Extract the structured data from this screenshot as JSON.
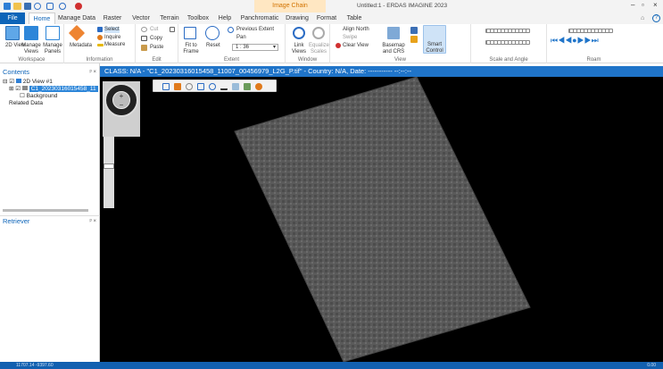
{
  "titlebar": {
    "context_group": "Image Chain",
    "window_title": "Untitled:1 - ERDAS IMAGINE 2023",
    "quick_access": [
      "folder-open-icon",
      "save-icon",
      "undo-icon",
      "cursor-icon",
      "zoom-icon",
      "close-icon"
    ]
  },
  "tabs": [
    "File",
    "Home",
    "Manage Data",
    "Raster",
    "Vector",
    "Terrain",
    "Toolbox",
    "Help",
    "Panchromatic",
    "Drawing",
    "Format",
    "Table"
  ],
  "ribbon": {
    "workspace": {
      "label": "Workspace",
      "buttons": [
        "2D View",
        "Manage Views",
        "Manage Panels"
      ]
    },
    "information": {
      "label": "Information",
      "buttons": [
        "Metadata",
        "Select",
        "Inquire",
        "Measure"
      ]
    },
    "edit": {
      "label": "Edit",
      "buttons": [
        "Cut",
        "Copy",
        "Paste"
      ]
    },
    "extent": {
      "label": "Extent",
      "buttons": [
        "Fit to Frame",
        "Reset",
        "Previous Extent",
        "Pan"
      ],
      "scale": "1 : 36"
    },
    "window": {
      "label": "Window",
      "buttons": [
        "Link Views",
        "Equalize Scales"
      ]
    },
    "view": {
      "label": "View",
      "buttons": [
        "Align North",
        "Swipe",
        "Clear View",
        "Basemap and CRS",
        "Smart Control"
      ]
    },
    "scale_angle": {
      "label": "Scale and Angle"
    },
    "roam": {
      "label": "Roam"
    }
  },
  "contents": {
    "title": "Contents",
    "ctrl": "ᵖ ×",
    "items": [
      "2D View #1",
      "C1_20230316015458_11",
      "Background",
      "Related Data"
    ]
  },
  "retriever": {
    "title": "Retriever",
    "ctrl": "ᵖ ×"
  },
  "view_header": "CLASS: N/A - \"C1_20230316015458_11007_00456979_L2G_P.tif\" - Country: N/A, Date: ----------- --:--:--",
  "status": {
    "coords": "11707.14  -9397.60",
    "value": "0.00"
  },
  "colors": {
    "accent": "#1f74c9",
    "file_tab": "#0d64b8",
    "status": "#1260b0",
    "image": "#555555"
  }
}
